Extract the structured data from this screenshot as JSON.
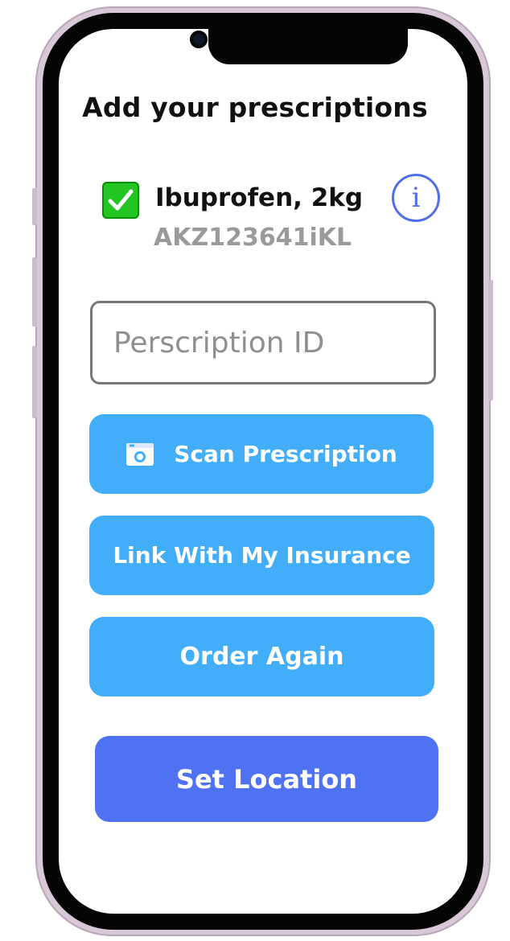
{
  "page": {
    "title": "Add your prescriptions"
  },
  "prescription": {
    "checked": true,
    "name": "Ibuprofen, 2kg",
    "id": "AKZ123641iKL",
    "info_icon": "info-icon",
    "info_symbol": "i"
  },
  "input": {
    "placeholder": "Perscription ID",
    "value": ""
  },
  "buttons": {
    "scan_label": "Scan Prescription",
    "scan_icon": "camera-icon",
    "insurance_label": "Link With My Insurance",
    "order_label": "Order Again",
    "location_label": "Set Location"
  },
  "colors": {
    "check_green": "#22c522",
    "button_blue": "#42adf8",
    "primary_blue": "#4f72f2",
    "info_blue": "#4f6ee8"
  }
}
